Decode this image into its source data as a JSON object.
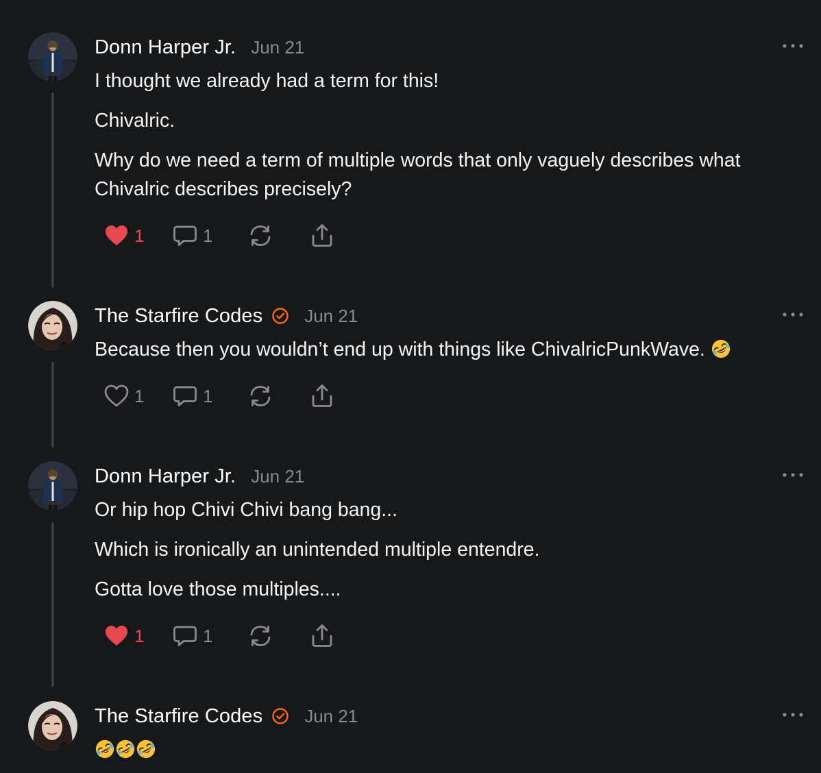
{
  "comments": [
    {
      "author": "Donn Harper Jr.",
      "date": "Jun 21",
      "verified": false,
      "avatar": "man-portrait-avatar",
      "paragraphs": [
        "I thought we already had a term for this!",
        "Chivalric.",
        "Why do we need a term of multiple words that only vaguely describes what",
        "Chivalric describes precisely?"
      ],
      "likes": "1",
      "liked": true,
      "replies": "1"
    },
    {
      "author": "The Starfire Codes",
      "date": "Jun 21",
      "verified": true,
      "avatar": "woman-portrait-avatar",
      "paragraphs": [
        "Because then you wouldn’t end up with things like ChivalricPunkWave."
      ],
      "trailing_emoji": "rolling-on-floor-laughing-emoji",
      "likes": "1",
      "liked": false,
      "replies": "1"
    },
    {
      "author": "Donn Harper Jr.",
      "date": "Jun 21",
      "verified": false,
      "avatar": "man-portrait-avatar",
      "paragraphs": [
        "Or hip hop Chivi Chivi bang bang...",
        "Which is ironically an unintended multiple entendre.",
        "Gotta love those multiples...."
      ],
      "likes": "1",
      "liked": true,
      "replies": "1"
    },
    {
      "author": "The Starfire Codes",
      "date": "Jun 21",
      "verified": true,
      "avatar": "woman-portrait-avatar",
      "emoji_body": [
        "rolling-on-floor-laughing-emoji",
        "rolling-on-floor-laughing-emoji",
        "rolling-on-floor-laughing-emoji"
      ]
    }
  ],
  "colors": {
    "background": "#17181a",
    "text": "#f4f4f5",
    "muted": "#8a8b8f",
    "like_red": "#e8484f",
    "verified_orange": "#ff6719",
    "thread_line": "#3c3d40"
  },
  "icons": {
    "like": "heart-icon",
    "reply": "comment-bubble-icon",
    "restack": "restack-arrows-icon",
    "share": "share-upload-icon",
    "more": "more-options-icon",
    "verified": "verified-check-badge-icon"
  }
}
